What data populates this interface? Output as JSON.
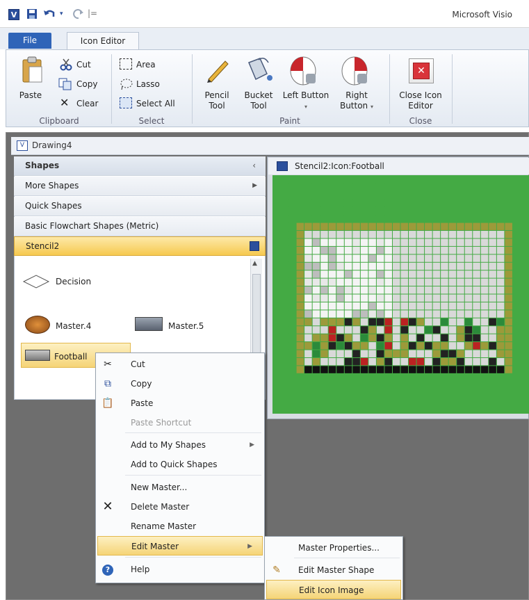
{
  "app": {
    "title": "Microsoft Visio",
    "logo": "V"
  },
  "quick_access": {
    "save_icon": "save-icon",
    "undo_icon": "undo-icon",
    "redo_icon": "redo-icon",
    "customize": "|="
  },
  "tabs": [
    {
      "label": "File"
    },
    {
      "label": "Icon Editor"
    }
  ],
  "ribbon": {
    "clipboard": {
      "paste": "Paste",
      "cut": "Cut",
      "copy": "Copy",
      "clear": "Clear",
      "group": "Clipboard"
    },
    "select": {
      "area": "Area",
      "lasso": "Lasso",
      "select_all": "Select All",
      "group": "Select"
    },
    "paint": {
      "pencil": "Pencil Tool",
      "bucket": "Bucket Tool",
      "left": "Left Button",
      "right": "Right Button",
      "group": "Paint",
      "left_color": "#c8262c",
      "right_color": "#c8262c"
    },
    "close": {
      "close_editor": "Close Icon Editor",
      "group": "Close",
      "close_color": "#d9343a"
    }
  },
  "drawing": {
    "title": "Drawing4"
  },
  "shapes_panel": {
    "header": "Shapes",
    "rows": [
      "More Shapes",
      "Quick Shapes",
      "Basic Flowchart Shapes (Metric)",
      "Stencil2"
    ],
    "masters": [
      "Decision",
      "Master.4",
      "Master.5",
      "Football"
    ]
  },
  "icon_window": {
    "title": "Stencil2:Icon:Football"
  },
  "context_menu": {
    "items": [
      "Cut",
      "Copy",
      "Paste",
      "Paste Shortcut",
      "Add to My Shapes",
      "Add to Quick Shapes",
      "New Master...",
      "Delete Master",
      "Rename Master",
      "Edit Master",
      "Help"
    ]
  },
  "submenu": {
    "items": [
      "Master Properties...",
      "Edit Master Shape",
      "Edit Icon Image"
    ]
  },
  "colors": {
    "grid_green": "#44aa44",
    "grid_olive": "#9c9a3a",
    "highlight": "#f6d47a"
  }
}
